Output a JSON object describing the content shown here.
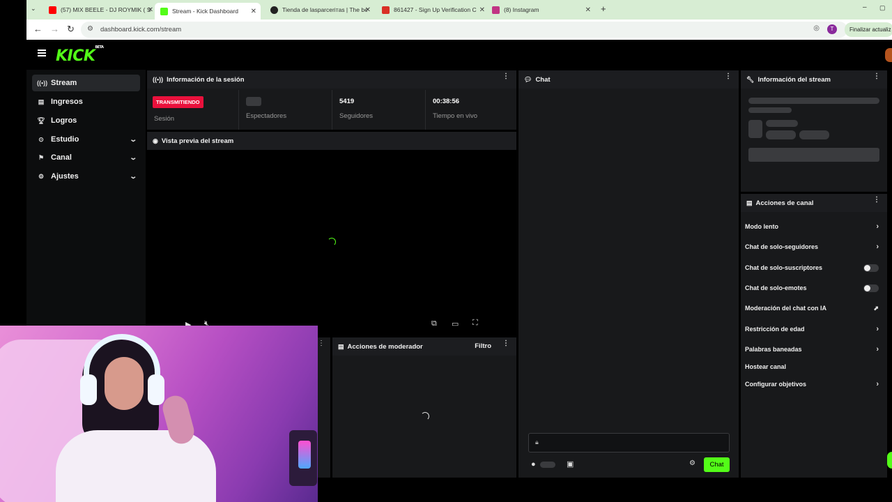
{
  "browser": {
    "tabs": [
      {
        "title": "(57) MIX BEELE - DJ ROYMIK ( S",
        "icon": "youtube-icon",
        "color": "#ff0000"
      },
      {
        "title": "Stream - Kick Dashboard",
        "icon": "kick-icon",
        "color": "#53fc18"
      },
      {
        "title": "Tienda de lasparcerітas | The be",
        "icon": "github-icon",
        "color": "#222222"
      },
      {
        "title": "861427 - Sign Up Verification C",
        "icon": "gmail-icon",
        "color": "#d93025"
      },
      {
        "title": "(8) Instagram",
        "icon": "instagram-icon",
        "color": "#c13584"
      }
    ],
    "url": "dashboard.kick.com/stream",
    "profile_initial": "T",
    "update_label": "Finalizar actualiz"
  },
  "sidebar": {
    "items": [
      {
        "label": "Stream",
        "icon": "broadcast-icon"
      },
      {
        "label": "Ingresos",
        "icon": "money-icon"
      },
      {
        "label": "Logros",
        "icon": "trophy-icon"
      },
      {
        "label": "Estudio",
        "icon": "studio-icon"
      },
      {
        "label": "Canal",
        "icon": "channel-icon"
      },
      {
        "label": "Ajustes",
        "icon": "settings-icon"
      }
    ]
  },
  "session": {
    "title": "Información de la sesión",
    "live_badge": "TRANSMITIENDO",
    "session_label": "Sesión",
    "viewers_label": "Espectadores",
    "followers_value": "5419",
    "followers_label": "Seguidores",
    "live_time_value": "00:38:56",
    "live_time_label": "Tiempo en vivo"
  },
  "preview": {
    "title": "Vista previa del stream"
  },
  "moderator": {
    "title": "Acciones de moderador",
    "filter_label": "Filtro"
  },
  "chat": {
    "title": "Chat",
    "send_label": "Chat"
  },
  "stream_info": {
    "title": "Información del stream"
  },
  "channel_actions": {
    "title": "Acciones de canal",
    "rows": [
      {
        "label": "Modo lento",
        "control": "chevron"
      },
      {
        "label": "Chat de solo-seguidores",
        "control": "chevron"
      },
      {
        "label": "Chat de solo-suscriptores",
        "control": "toggle"
      },
      {
        "label": "Chat de solo-emotes",
        "control": "toggle"
      },
      {
        "label": "Moderación del chat con IA",
        "control": "external"
      },
      {
        "label": "Restricción de edad",
        "control": "chevron"
      },
      {
        "label": "Palabras baneadas",
        "control": "chevron"
      },
      {
        "label": "Hostear canal",
        "control": "none"
      },
      {
        "label": "Configurar objetivos",
        "control": "chevron"
      }
    ]
  },
  "colors": {
    "accent": "#53fc18",
    "live": "#e9113c"
  }
}
